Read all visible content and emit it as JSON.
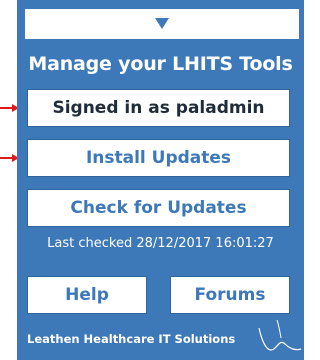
{
  "panel": {
    "title": "Manage your LHITS Tools",
    "buttons": {
      "signed_in": "Signed in as paladmin",
      "install_updates": "Install Updates",
      "check_updates": "Check for Updates",
      "help": "Help",
      "forums": "Forums"
    },
    "last_checked": "Last checked 28/12/2017 16:01:27",
    "footer": "Leathen Healthcare IT Solutions"
  },
  "icons": {
    "collapse": "chevron-down-icon",
    "pointer_arrows": "red-arrow-icon",
    "logo": "signature-wave-logo"
  },
  "colors": {
    "panel_bg": "#3d78b8",
    "button_text": "#3d78b8",
    "arrow": "#e0191c"
  }
}
